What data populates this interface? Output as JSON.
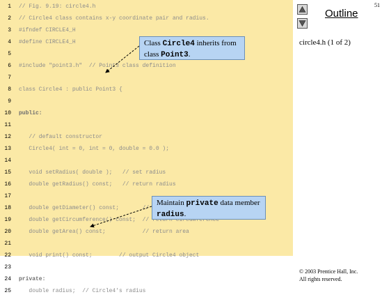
{
  "page_number": "51",
  "outline": {
    "title": "Outline",
    "subtitle": "circle4.h (1 of 2)",
    "up_icon": "triangle-up-icon",
    "down_icon": "triangle-down-icon"
  },
  "copyright": {
    "line1": "© 2003 Prentice Hall, Inc.",
    "line2": "All rights reserved."
  },
  "code_lines": [
    {
      "num": "1",
      "text": "// Fig. 9.19: circle4.h",
      "bold": false
    },
    {
      "num": "2",
      "text": "// Circle4 class contains x-y coordinate pair and radius.",
      "bold": false
    },
    {
      "num": "3",
      "text": "#ifndef CIRCLE4_H",
      "bold": false
    },
    {
      "num": "4",
      "text": "#define CIRCLE4_H",
      "bold": false
    },
    {
      "num": "5",
      "text": "",
      "bold": false
    },
    {
      "num": "6",
      "text": "#include \"point3.h\"  // Point3 class definition",
      "bold": false
    },
    {
      "num": "7",
      "text": "",
      "bold": false
    },
    {
      "num": "8",
      "text": "class Circle4 : public Point3 {",
      "bold": false
    },
    {
      "num": "9",
      "text": "",
      "bold": false
    },
    {
      "num": "10",
      "text": "public:",
      "bold": true
    },
    {
      "num": "11",
      "text": "",
      "bold": false
    },
    {
      "num": "12",
      "text": "   // default constructor",
      "bold": false
    },
    {
      "num": "13",
      "text": "   Circle4( int = 0, int = 0, double = 0.0 );",
      "bold": false
    },
    {
      "num": "14",
      "text": "",
      "bold": false
    },
    {
      "num": "15",
      "text": "   void setRadius( double );   // set radius",
      "bold": false
    },
    {
      "num": "16",
      "text": "   double getRadius() const;   // return radius",
      "bold": false
    },
    {
      "num": "17",
      "text": "",
      "bold": false
    },
    {
      "num": "18",
      "text": "   double getDiameter() const;       // return diameter",
      "bold": false
    },
    {
      "num": "19",
      "text": "   double getCircumference() const;  // return circumference",
      "bold": false
    },
    {
      "num": "20",
      "text": "   double getArea() const;           // return area",
      "bold": false
    },
    {
      "num": "21",
      "text": "",
      "bold": false
    },
    {
      "num": "22",
      "text": "   void print() const;        // output Circle4 object",
      "bold": false
    },
    {
      "num": "23",
      "text": "",
      "bold": false
    },
    {
      "num": "24",
      "text": "private:",
      "bold": true
    },
    {
      "num": "25",
      "text": "   double radius;  // Circle4's radius",
      "bold": false
    }
  ],
  "callouts": [
    {
      "pre": "Class ",
      "code": "Circle4",
      "mid": " inherits from class ",
      "code2": "Point3",
      "post": "."
    },
    {
      "pre": "Maintain ",
      "code": "private",
      "mid": " data member ",
      "code2": "radius",
      "post": "."
    }
  ]
}
